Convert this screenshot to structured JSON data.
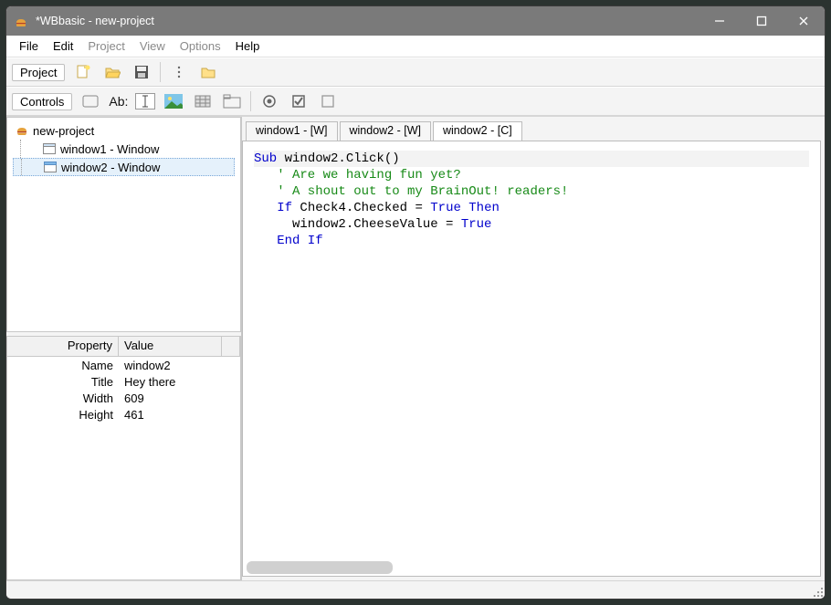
{
  "titlebar": {
    "title": "*WBbasic - new-project"
  },
  "menu": {
    "file": "File",
    "edit": "Edit",
    "project": "Project",
    "view": "View",
    "options": "Options",
    "help": "Help"
  },
  "toolbar1": {
    "project": "Project"
  },
  "toolbar2": {
    "controls": "Controls",
    "ab": "Ab:"
  },
  "tree": {
    "root": "new-project",
    "items": [
      {
        "label": "window1 - Window"
      },
      {
        "label": "window2 - Window"
      }
    ]
  },
  "properties": {
    "header_prop": "Property",
    "header_val": "Value",
    "rows": [
      {
        "k": "Name",
        "v": "window2"
      },
      {
        "k": "Title",
        "v": "Hey there"
      },
      {
        "k": "Width",
        "v": "609"
      },
      {
        "k": "Height",
        "v": "461"
      }
    ]
  },
  "tabs": [
    {
      "label": "window1 - [W]"
    },
    {
      "label": "window2 - [W]"
    },
    {
      "label": "window2 - [C]"
    }
  ],
  "code": {
    "l1a": "Sub",
    "l1b": " window2.Click()",
    "l2": "   ' Are we having fun yet?",
    "l3": "   ' A shout out to my BrainOut! readers!",
    "l4a": "   ",
    "l4b": "If",
    "l4c": " Check4.Checked = ",
    "l4d": "True",
    "l4e": " ",
    "l4f": "Then",
    "l5a": "     window2.CheeseValue = ",
    "l5b": "True",
    "l6": "   End If"
  }
}
